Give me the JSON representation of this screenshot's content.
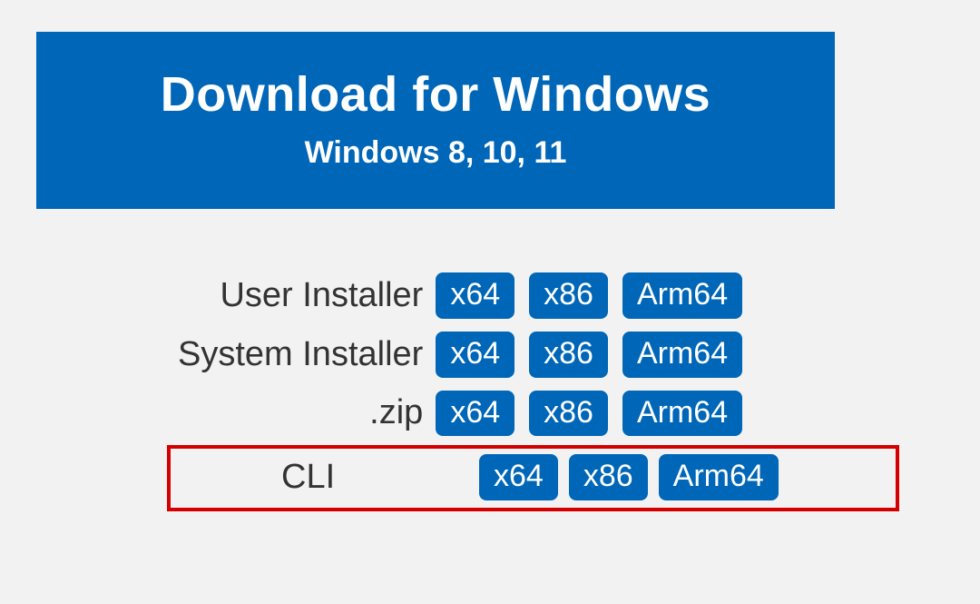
{
  "hero": {
    "title": "Download for Windows",
    "subtitle": "Windows 8, 10, 11"
  },
  "rows": [
    {
      "label": "User Installer",
      "arch": [
        "x64",
        "x86",
        "Arm64"
      ]
    },
    {
      "label": "System Installer",
      "arch": [
        "x64",
        "x86",
        "Arm64"
      ]
    },
    {
      "label": ".zip",
      "arch": [
        "x64",
        "x86",
        "Arm64"
      ]
    },
    {
      "label": "CLI",
      "arch": [
        "x64",
        "x86",
        "Arm64"
      ],
      "highlight": true
    }
  ],
  "colors": {
    "brand": "#0066b8",
    "highlight": "#d40000",
    "bg": "#f2f2f2"
  }
}
